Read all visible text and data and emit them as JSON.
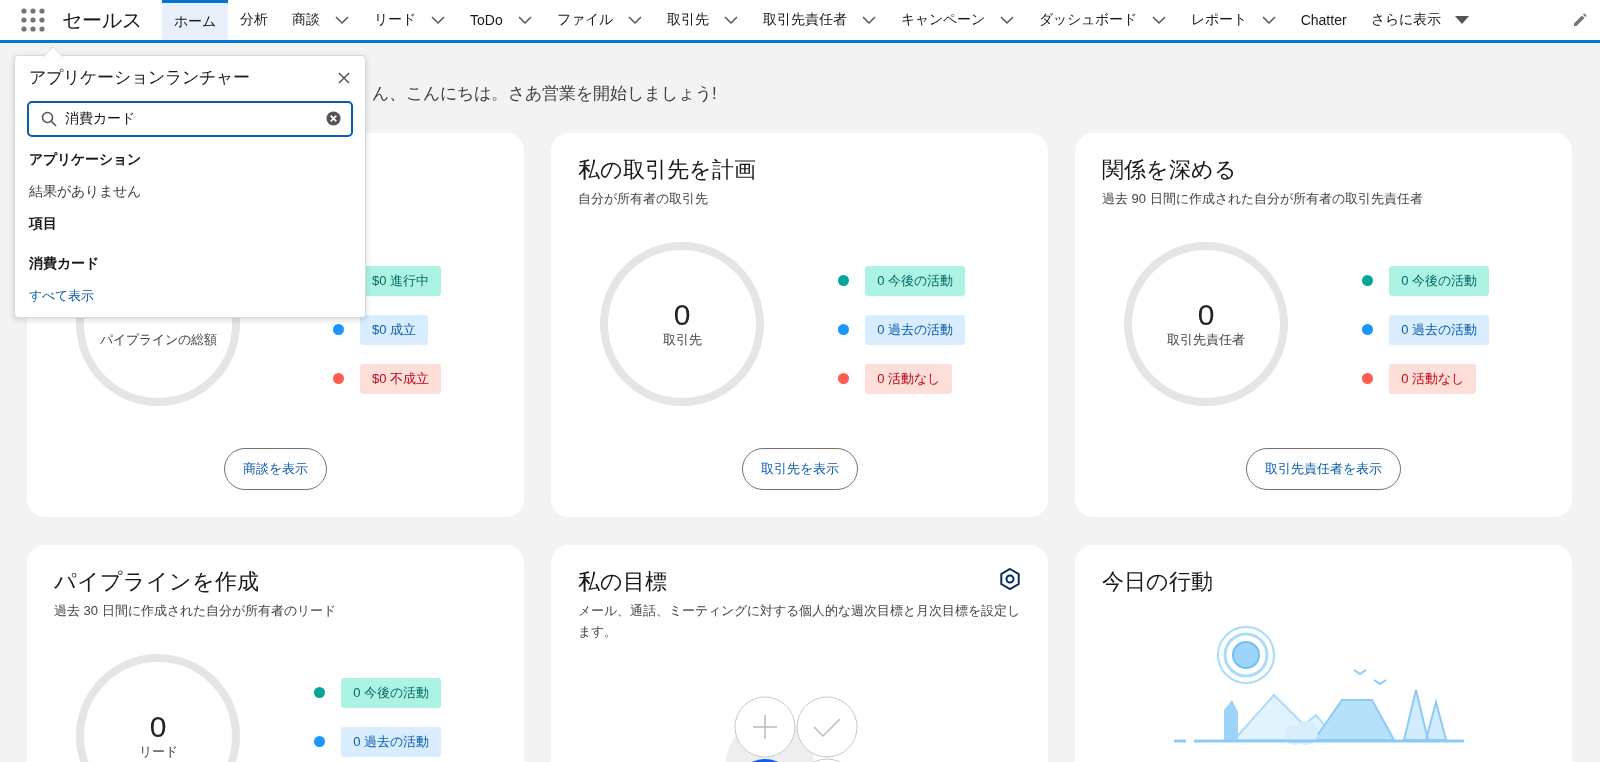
{
  "app_name": "セールス",
  "nav": [
    {
      "label": "ホーム",
      "selected": true,
      "kind": "plain"
    },
    {
      "label": "分析",
      "selected": false,
      "kind": "plain"
    },
    {
      "label": "商談",
      "selected": false,
      "kind": "dropdown"
    },
    {
      "label": "リード",
      "selected": false,
      "kind": "dropdown"
    },
    {
      "label": "ToDo",
      "selected": false,
      "kind": "dropdown"
    },
    {
      "label": "ファイル",
      "selected": false,
      "kind": "dropdown"
    },
    {
      "label": "取引先",
      "selected": false,
      "kind": "dropdown"
    },
    {
      "label": "取引先責任者",
      "selected": false,
      "kind": "dropdown"
    },
    {
      "label": "キャンペーン",
      "selected": false,
      "kind": "dropdown"
    },
    {
      "label": "ダッシュボード",
      "selected": false,
      "kind": "dropdown"
    },
    {
      "label": "レポート",
      "selected": false,
      "kind": "dropdown"
    },
    {
      "label": "Chatter",
      "selected": false,
      "kind": "plain"
    },
    {
      "label": "さらに表示",
      "selected": false,
      "kind": "more"
    }
  ],
  "greeting": "ん、こんにちは。さあ営業を開始しましょう!",
  "launcher": {
    "title": "アプリケーションランチャー",
    "search_value": "消費カード",
    "sections": [
      {
        "kind": "heading",
        "text": "アプリケーション"
      },
      {
        "kind": "note",
        "text": "結果がありません"
      },
      {
        "kind": "heading",
        "text": "項目"
      },
      {
        "kind": "item",
        "text": "消費カード"
      },
      {
        "kind": "link",
        "text": "すべて表示"
      }
    ]
  },
  "cards": [
    {
      "kind": "summary",
      "total_label": "パイプラインの総額",
      "legend": [
        {
          "label": "$0 進行中",
          "kind": "positive"
        },
        {
          "label": "$0 成立",
          "kind": "info",
          "color": "#1b96ff"
        },
        {
          "label": "$0 不成立",
          "kind": "negative",
          "color": "#fe5c4c"
        }
      ],
      "button": "商談を表示"
    },
    {
      "kind": "summary",
      "title": "私の取引先を計画",
      "subtitle": "自分が所有者の取引先",
      "total": "0",
      "total_label": "取引先",
      "legend": [
        {
          "label": "0 今後の活動",
          "kind": "positive",
          "color": "#06a59a"
        },
        {
          "label": "0 過去の活動",
          "kind": "info",
          "color": "#1b96ff"
        },
        {
          "label": "0 活動なし",
          "kind": "negative",
          "color": "#fe5c4c"
        }
      ],
      "button": "取引先を表示"
    },
    {
      "kind": "summary",
      "title": "関係を深める",
      "subtitle": "過去 90 日間に作成された自分が所有者の取引先責任者",
      "total": "0",
      "total_label": "取引先責任者",
      "legend": [
        {
          "label": "0 今後の活動",
          "kind": "positive",
          "color": "#06a59a"
        },
        {
          "label": "0 過去の活動",
          "kind": "info",
          "color": "#1b96ff"
        },
        {
          "label": "0 活動なし",
          "kind": "negative",
          "color": "#fe5c4c"
        }
      ],
      "button": "取引先責任者を表示"
    },
    {
      "kind": "summary",
      "title": "パイプラインを作成",
      "subtitle": "過去 30 日間に作成された自分が所有者のリード",
      "total": "0",
      "total_label": "リード",
      "legend": [
        {
          "label": "0 今後の活動",
          "kind": "positive",
          "color": "#06a59a"
        },
        {
          "label": "0 過去の活動",
          "kind": "info",
          "color": "#1b96ff"
        }
      ]
    },
    {
      "kind": "goals",
      "title": "私の目標",
      "subtitle": "メール、通話、ミーティングに対する個人的な週次目標と月次目標を設定します。"
    },
    {
      "kind": "today",
      "title": "今日の行動"
    }
  ]
}
